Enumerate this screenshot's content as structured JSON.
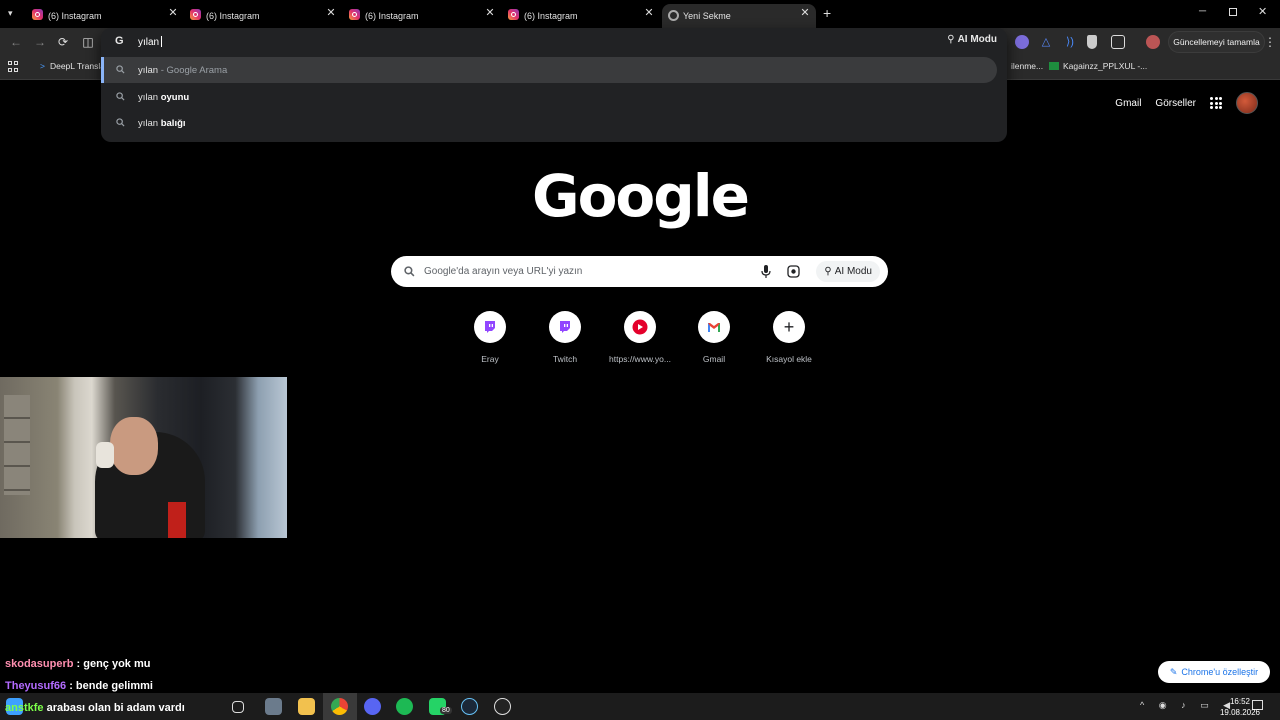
{
  "tabs": [
    {
      "label": "(6) Instagram",
      "active": false
    },
    {
      "label": "(6) Instagram",
      "active": false
    },
    {
      "label": "(6) Instagram",
      "active": false
    },
    {
      "label": "(6) Instagram",
      "active": false
    },
    {
      "label": "Yeni Sekme",
      "active": true
    }
  ],
  "omnibox": {
    "typed": "yılan",
    "ai_mode_label": "AI Modu",
    "suggestions": [
      {
        "prefix": "yılan",
        "bold": "",
        "sub": " - Google Arama"
      },
      {
        "prefix": "yılan ",
        "bold": "oyunu",
        "sub": ""
      },
      {
        "prefix": "yılan ",
        "bold": "balığı",
        "sub": ""
      }
    ]
  },
  "toolbar": {
    "update_label": "Güncellemeyi tamamla"
  },
  "bookmarks": {
    "deepl": "DeepL Transla",
    "partial": "ilenme...",
    "kagainzz": "Kagainzz_PPLXUL -..."
  },
  "google": {
    "gmail_link": "Gmail",
    "images_link": "Görseller",
    "logo": "Google",
    "search_placeholder": "Google'da arayın veya URL'yi yazın",
    "ai_mode_label": "AI Modu",
    "shortcuts": [
      {
        "label": "Eray",
        "icon": "twitch-icon"
      },
      {
        "label": "Twitch",
        "icon": "twitch-icon"
      },
      {
        "label": "https://www.yo...",
        "icon": "youtube-icon"
      },
      {
        "label": "Gmail",
        "icon": "gmail-icon"
      },
      {
        "label": "Kısayol ekle",
        "icon": "plus-icon"
      }
    ],
    "customize_label": "Chrome'u özelleştir"
  },
  "chat": [
    {
      "user": "skodasuperb",
      "msg": " : genç yok mu",
      "color": "#ff8fb0"
    },
    {
      "user": "Theyusuf66",
      "msg": " : bende gelimmi",
      "color": "#b36bff"
    },
    {
      "user": "anstkfe",
      "msg": " arabası olan bi adam vardı",
      "color": "#7cff4a"
    }
  ],
  "taskbar": {
    "time": "16:52",
    "date": "19.08.2026",
    "whatsapp_badge": "80"
  },
  "colors": {
    "accent": "#8ab4f8",
    "instagram": "#e1306c",
    "twitch": "#9146ff",
    "youtube": "#ff0000"
  }
}
